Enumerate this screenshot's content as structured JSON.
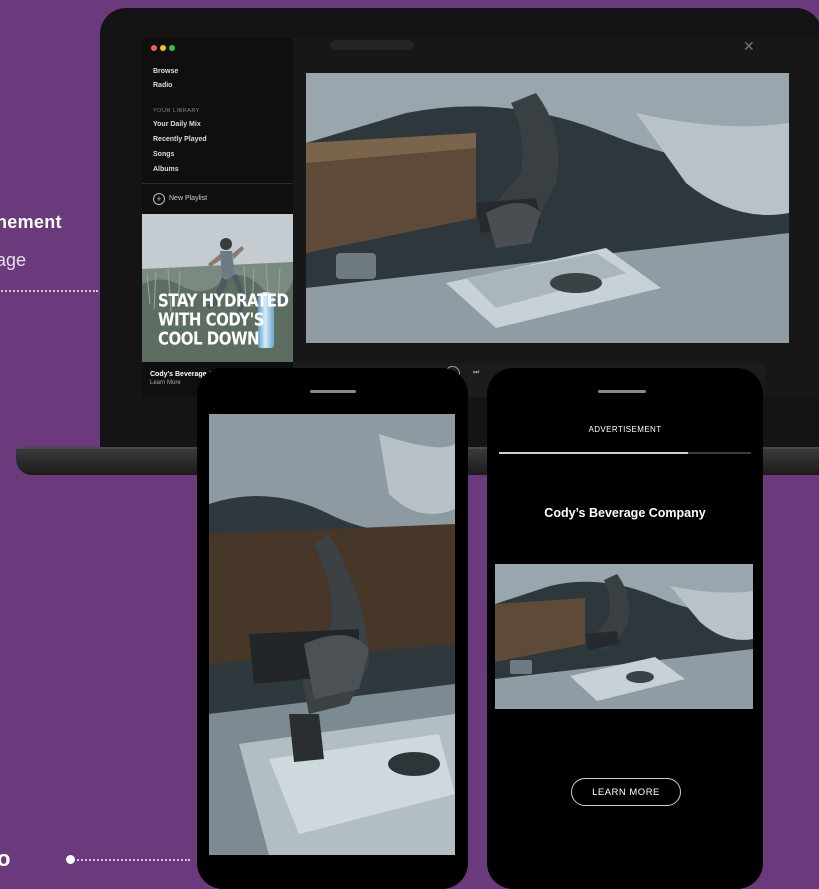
{
  "left_text": {
    "line1": "nement",
    "line2": "age",
    "bottom": "o"
  },
  "desktop_app": {
    "nav": {
      "browse": "Browse",
      "radio": "Radio",
      "library_header": "YOUR LIBRARY",
      "daily_mix": "Your Daily Mix",
      "recently_played": "Recently Played",
      "songs": "Songs",
      "albums": "Albums",
      "new_playlist": "New Playlist"
    },
    "banner_ad": {
      "lines": [
        "STAY HYDRATED",
        "WITH CODY'S",
        "COOL DOWN"
      ]
    },
    "now_playing": {
      "title": "Cody's Beverage C",
      "action": "Learn More"
    }
  },
  "mobile_ad": {
    "header": "ADVERTISEMENT",
    "progress": 0.75,
    "company": "Cody’s Beverage Company",
    "cta": "LEARN MORE"
  },
  "colors": {
    "background": "#6b3a7c",
    "device": "#000000"
  },
  "icons": [
    "close-icon",
    "plus-circle-icon",
    "play-icon",
    "next-icon"
  ]
}
